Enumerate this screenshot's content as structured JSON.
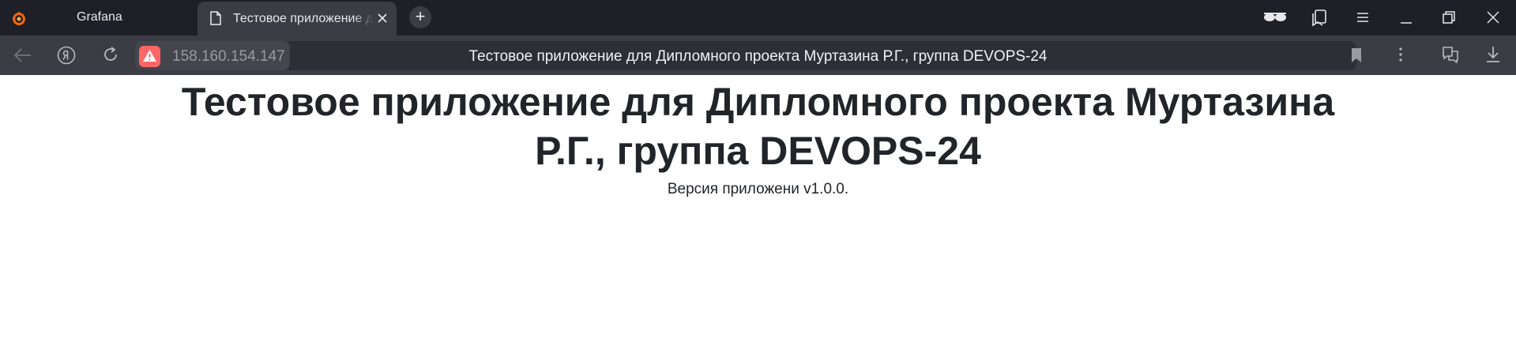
{
  "tabs": [
    {
      "label": "Grafana",
      "icon": "grafana-logo-icon",
      "active": false
    },
    {
      "label": "Тестовое приложение для Дипломного проекта Муртазина Р.Г., группа DEVOPS-24",
      "icon": "document-icon",
      "active": true
    }
  ],
  "new_tab_label": "+",
  "address": {
    "host": "158.160.154.147",
    "title": "Тестовое приложение для Дипломного проекта Муртазина Р.Г., группа DEVOPS-24"
  },
  "page": {
    "heading": "Тестовое приложение для Дипломного проекта Муртазина Р.Г., группа DEVOPS-24",
    "version": "Версия приложени v1.0.0."
  },
  "colors": {
    "tabbar": "#1f1f27",
    "toolbar": "#3c3c44",
    "warning": "#ff6666",
    "heading": "#212529"
  }
}
